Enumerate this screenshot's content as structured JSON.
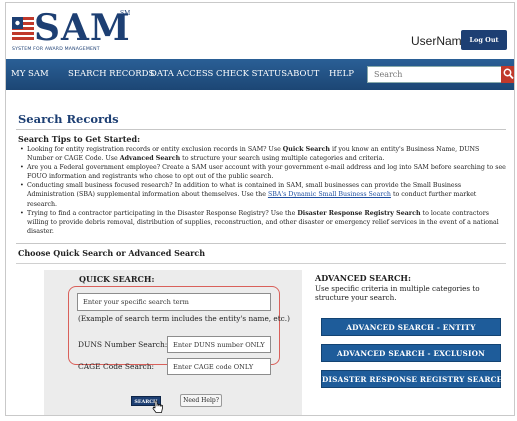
{
  "header": {
    "logo_text": "SAM",
    "logo_tm": "SM",
    "tagline": "SYSTEM FOR AWARD MANAGEMENT",
    "username": "UserName",
    "logout_label": "Log Out"
  },
  "nav": {
    "items": [
      "MY SAM",
      "SEARCH RECORDS",
      "DATA ACCESS",
      "CHECK STATUS",
      "ABOUT",
      "HELP"
    ],
    "search_placeholder": "Search"
  },
  "page_title": "Search Records",
  "tips": {
    "heading": "Search Tips to Get Started:",
    "items": [
      [
        "Looking for entity registration records or entity exclusion records in SAM? Use ",
        "Quick Search",
        " if you know an entity's Business Name, DUNS Number or CAGE Code. Use ",
        "Advanced Search",
        " to structure your search using multiple categories and criteria."
      ],
      [
        "Are you a Federal government employee? Create a SAM user account with your government e-mail address and log into SAM before searching to see FOUO information and registrants who chose to opt out of the public search."
      ],
      [
        "Conducting small business focused research? In addition to what is contained in SAM, small businesses can provide the Small Business Administration (SBA) supplemental information about themselves. Use the ",
        "SBA's Dynamic Small Business Search",
        " to conduct further market research."
      ],
      [
        "Trying to find a contractor participating in the Disaster Response Registry? Use the ",
        "Disaster Response Registry Search",
        " to locate contractors willing to provide debris removal, distribution of supplies, reconstruction, and other disaster or emergency relief services in the event of a national disaster."
      ]
    ]
  },
  "choose_heading": "Choose Quick Search or Advanced Search",
  "quick_search": {
    "title": "QUICK SEARCH:",
    "input_value": "Enter your specific search term",
    "example": "(Example of search term includes the entity's name, etc.)",
    "duns_label": "DUNS Number Search:",
    "duns_value": "Enter DUNS number ONLY",
    "cage_label": "CAGE Code Search:",
    "cage_value": "Enter CAGE code ONLY",
    "search_label": "SEARCH",
    "help_label": "Need Help?"
  },
  "advanced_search": {
    "title": "ADVANCED SEARCH:",
    "description": "Use specific criteria in multiple categories to structure your search.",
    "entity_label": "ADVANCED SEARCH - ENTITY",
    "exclusion_label": "ADVANCED SEARCH - EXCLUSION",
    "disaster_label": "DISASTER RESPONSE REGISTRY SEARCH"
  },
  "colors": {
    "brand_navy": "#1d3f73",
    "nav_blue": "#2a5f96",
    "button_blue": "#1e5c9a",
    "highlight_red": "#d9605a",
    "search_red": "#c0392b"
  }
}
